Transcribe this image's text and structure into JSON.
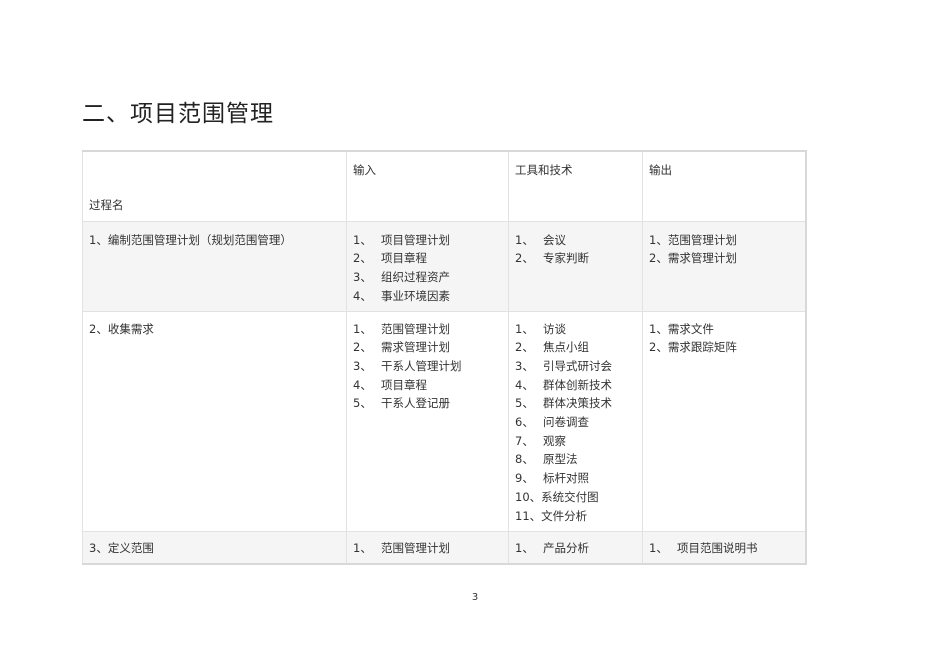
{
  "title": "二、项目范围管理",
  "table": {
    "headers": {
      "name": "过程名",
      "inputs": "输入",
      "tools": "工具和技术",
      "outputs": "输出"
    },
    "rows": [
      {
        "name": "1、编制范围管理计划（规划范围管理）",
        "inputs": [
          {
            "n": "1、",
            "t": "项目管理计划"
          },
          {
            "n": "2、",
            "t": "项目章程"
          },
          {
            "n": "3、",
            "t": "组织过程资产"
          },
          {
            "n": "4、",
            "t": "事业环境因素"
          }
        ],
        "tools": [
          {
            "n": "1、",
            "t": "会议"
          },
          {
            "n": "2、",
            "t": "专家判断"
          }
        ],
        "outputs": [
          {
            "n": "1、",
            "t": "范围管理计划"
          },
          {
            "n": "2、",
            "t": "需求管理计划"
          }
        ]
      },
      {
        "name": "2、收集需求",
        "inputs": [
          {
            "n": "1、",
            "t": "范围管理计划"
          },
          {
            "n": "2、",
            "t": "需求管理计划"
          },
          {
            "n": "3、",
            "t": "干系人管理计划"
          },
          {
            "n": "4、",
            "t": "项目章程"
          },
          {
            "n": "5、",
            "t": "干系人登记册"
          }
        ],
        "tools": [
          {
            "n": "1、",
            "t": "访谈"
          },
          {
            "n": "2、",
            "t": "焦点小组"
          },
          {
            "n": "3、",
            "t": "引导式研讨会"
          },
          {
            "n": "4、",
            "t": "群体创新技术"
          },
          {
            "n": "5、",
            "t": "群体决策技术"
          },
          {
            "n": "6、",
            "t": "问卷调查"
          },
          {
            "n": "7、",
            "t": "观察"
          },
          {
            "n": "8、",
            "t": "原型法"
          },
          {
            "n": "9、",
            "t": "标杆对照"
          },
          {
            "n": "10、",
            "t": "系统交付图"
          },
          {
            "n": "11、",
            "t": "文件分析"
          }
        ],
        "outputs": [
          {
            "n": "1、",
            "t": "需求文件"
          },
          {
            "n": "2、",
            "t": "需求跟踪矩阵"
          }
        ]
      },
      {
        "name": "3、定义范围",
        "inputs": [
          {
            "n": "1、",
            "t": "范围管理计划"
          }
        ],
        "tools": [
          {
            "n": "1、",
            "t": "产品分析"
          }
        ],
        "outputs": [
          {
            "n": "1、",
            "t": "项目范围说明书"
          }
        ]
      }
    ]
  },
  "page_number": "3"
}
